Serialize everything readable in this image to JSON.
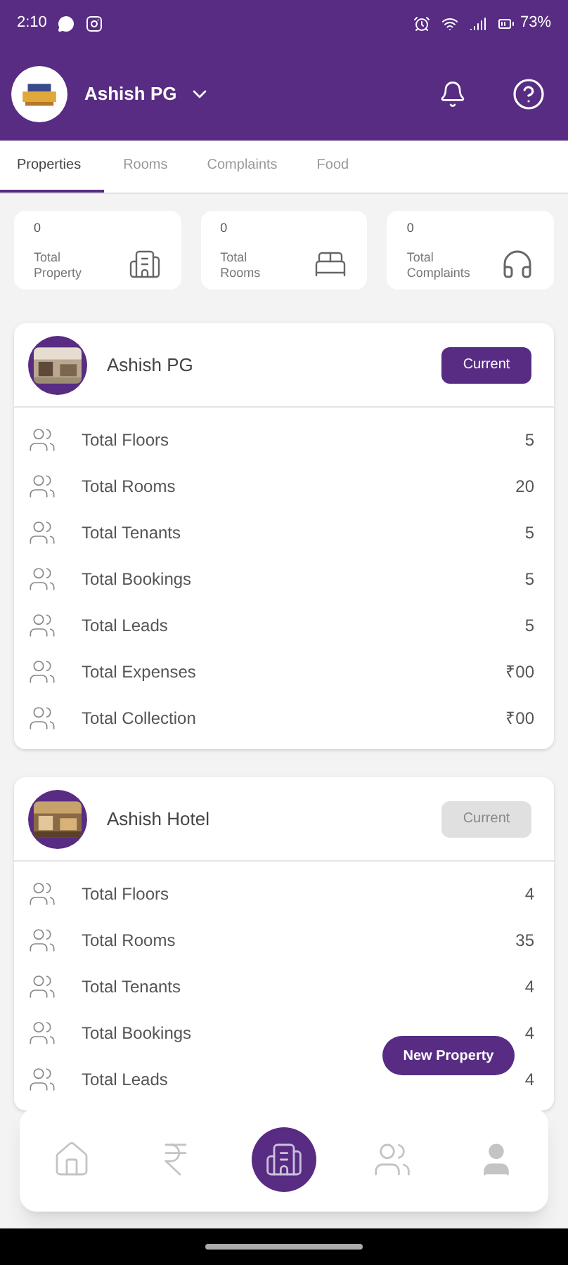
{
  "status_bar": {
    "time": "2:10",
    "battery": "73%"
  },
  "header": {
    "title": "Ashish PG"
  },
  "tabs": [
    {
      "label": "Properties",
      "selected": true
    },
    {
      "label": "Rooms",
      "selected": false
    },
    {
      "label": "Complaints",
      "selected": false
    },
    {
      "label": "Food",
      "selected": false
    }
  ],
  "stats": [
    {
      "kind": "building",
      "value": "0",
      "label": "Total Property"
    },
    {
      "kind": "bed",
      "value": "0",
      "label": "Total Rooms"
    },
    {
      "kind": "headset",
      "value": "0",
      "label": "Total Complaints"
    }
  ],
  "properties": [
    {
      "name": "Ashish PG",
      "button": "Current",
      "selected": true,
      "rows": [
        {
          "label": "Total Floors",
          "value": "5"
        },
        {
          "label": "Total Rooms",
          "value": "20"
        },
        {
          "label": "Total Tenants",
          "value": "5"
        },
        {
          "label": "Total Bookings",
          "value": "5"
        },
        {
          "label": "Total Leads",
          "value": "5"
        },
        {
          "label": "Total Expenses",
          "value": "₹00"
        },
        {
          "label": "Total Collection",
          "value": "₹00"
        }
      ]
    },
    {
      "name": "Ashish Hotel",
      "button": "Current",
      "selected": false,
      "rows": [
        {
          "label": "Total Floors",
          "value": "4"
        },
        {
          "label": "Total Rooms",
          "value": "35"
        },
        {
          "label": "Total Tenants",
          "value": "4"
        },
        {
          "label": "Total Bookings",
          "value": "4"
        },
        {
          "label": "Total Leads",
          "value": "4"
        }
      ]
    }
  ],
  "fab": {
    "label": "New Property"
  },
  "bottom_nav": [
    {
      "kind": "home",
      "selected": false
    },
    {
      "kind": "rupee",
      "selected": false
    },
    {
      "kind": "building",
      "selected": true
    },
    {
      "kind": "users",
      "selected": false
    },
    {
      "kind": "user",
      "selected": false
    }
  ]
}
